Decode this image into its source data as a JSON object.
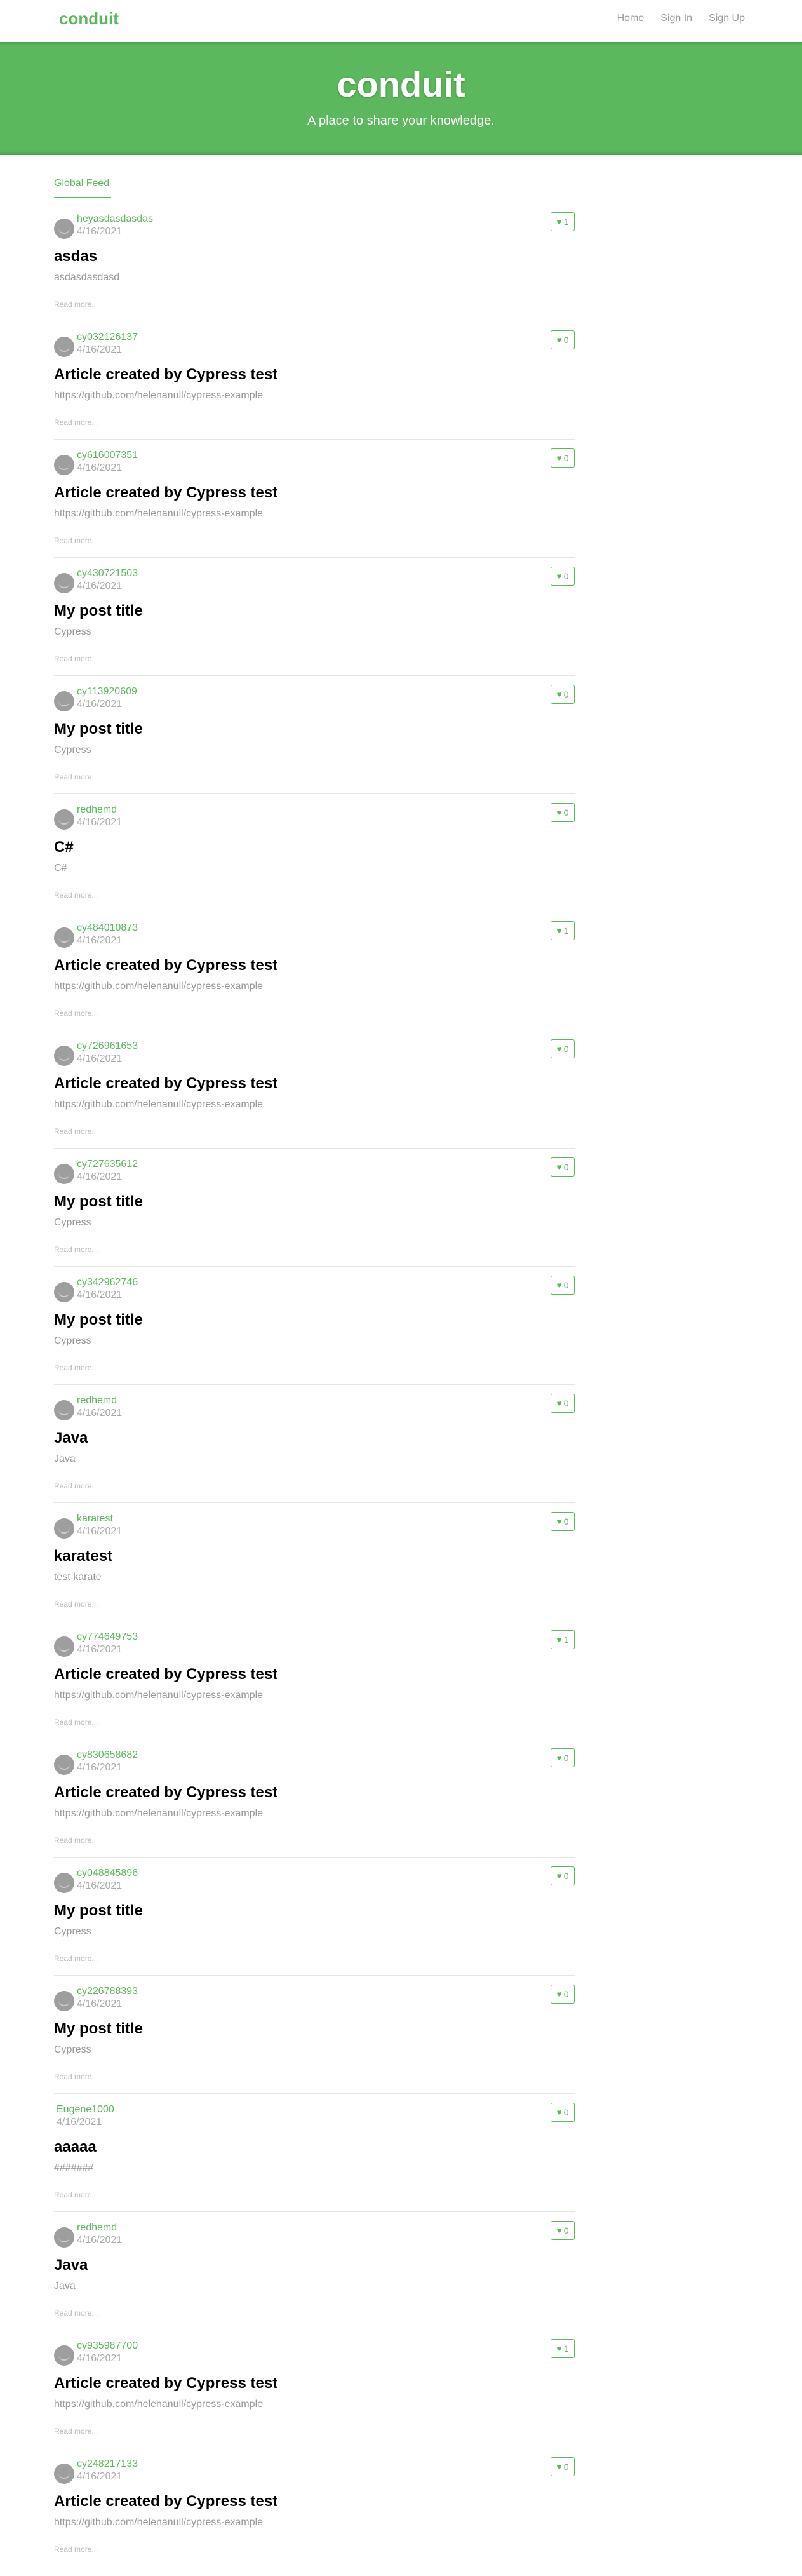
{
  "nav": {
    "brand": "conduit",
    "links": [
      "Home",
      "Sign In",
      "Sign Up"
    ]
  },
  "banner": {
    "title": "conduit",
    "subtitle": "A place to share your knowledge."
  },
  "feed": {
    "tab_label": "Global Feed"
  },
  "articles": [
    {
      "author": "heyasdasdasdas",
      "date": "4/16/2021",
      "likes": "1",
      "title": "asdas",
      "description": "asdasdasdasd",
      "read_more": "Read more...",
      "avatar": true
    },
    {
      "author": "cy032126137",
      "date": "4/16/2021",
      "likes": "0",
      "title": "Article created by Cypress test",
      "description": "https://github.com/helenanull/cypress-example",
      "read_more": "Read more...",
      "avatar": true
    },
    {
      "author": "cy616007351",
      "date": "4/16/2021",
      "likes": "0",
      "title": "Article created by Cypress test",
      "description": "https://github.com/helenanull/cypress-example",
      "read_more": "Read more...",
      "avatar": true
    },
    {
      "author": "cy430721503",
      "date": "4/16/2021",
      "likes": "0",
      "title": "My post title",
      "description": "Cypress",
      "read_more": "Read more...",
      "avatar": true
    },
    {
      "author": "cy113920609",
      "date": "4/16/2021",
      "likes": "0",
      "title": "My post title",
      "description": "Cypress",
      "read_more": "Read more...",
      "avatar": true
    },
    {
      "author": "redhemd",
      "date": "4/16/2021",
      "likes": "0",
      "title": "C#",
      "description": "C#",
      "read_more": "Read more...",
      "avatar": true
    },
    {
      "author": "cy484010873",
      "date": "4/16/2021",
      "likes": "1",
      "title": "Article created by Cypress test",
      "description": "https://github.com/helenanull/cypress-example",
      "read_more": "Read more...",
      "avatar": true
    },
    {
      "author": "cy726961653",
      "date": "4/16/2021",
      "likes": "0",
      "title": "Article created by Cypress test",
      "description": "https://github.com/helenanull/cypress-example",
      "read_more": "Read more...",
      "avatar": true
    },
    {
      "author": "cy727635612",
      "date": "4/16/2021",
      "likes": "0",
      "title": "My post title",
      "description": "Cypress",
      "read_more": "Read more...",
      "avatar": true
    },
    {
      "author": "cy342962746",
      "date": "4/16/2021",
      "likes": "0",
      "title": "My post title",
      "description": "Cypress",
      "read_more": "Read more...",
      "avatar": true
    },
    {
      "author": "redhemd",
      "date": "4/16/2021",
      "likes": "0",
      "title": "Java",
      "description": "Java",
      "read_more": "Read more...",
      "avatar": true
    },
    {
      "author": "karatest",
      "date": "4/16/2021",
      "likes": "0",
      "title": "karatest",
      "description": "test karate",
      "read_more": "Read more...",
      "avatar": true
    },
    {
      "author": "cy774649753",
      "date": "4/16/2021",
      "likes": "1",
      "title": "Article created by Cypress test",
      "description": "https://github.com/helenanull/cypress-example",
      "read_more": "Read more...",
      "avatar": true
    },
    {
      "author": "cy830658682",
      "date": "4/16/2021",
      "likes": "0",
      "title": "Article created by Cypress test",
      "description": "https://github.com/helenanull/cypress-example",
      "read_more": "Read more...",
      "avatar": true
    },
    {
      "author": "cy048845896",
      "date": "4/16/2021",
      "likes": "0",
      "title": "My post title",
      "description": "Cypress",
      "read_more": "Read more...",
      "avatar": true
    },
    {
      "author": "cy226788393",
      "date": "4/16/2021",
      "likes": "0",
      "title": "My post title",
      "description": "Cypress",
      "read_more": "Read more...",
      "avatar": true
    },
    {
      "author": "Eugene1000",
      "date": "4/16/2021",
      "likes": "0",
      "title": "aaaaa",
      "description": "#######",
      "read_more": "Read more...",
      "avatar": false
    },
    {
      "author": "redhemd",
      "date": "4/16/2021",
      "likes": "0",
      "title": "Java",
      "description": "Java",
      "read_more": "Read more...",
      "avatar": true
    },
    {
      "author": "cy935987700",
      "date": "4/16/2021",
      "likes": "1",
      "title": "Article created by Cypress test",
      "description": "https://github.com/helenanull/cypress-example",
      "read_more": "Read more...",
      "avatar": true
    },
    {
      "author": "cy248217133",
      "date": "4/16/2021",
      "likes": "0",
      "title": "Article created by Cypress test",
      "description": "https://github.com/helenanull/cypress-example",
      "read_more": "Read more...",
      "avatar": true
    }
  ]
}
